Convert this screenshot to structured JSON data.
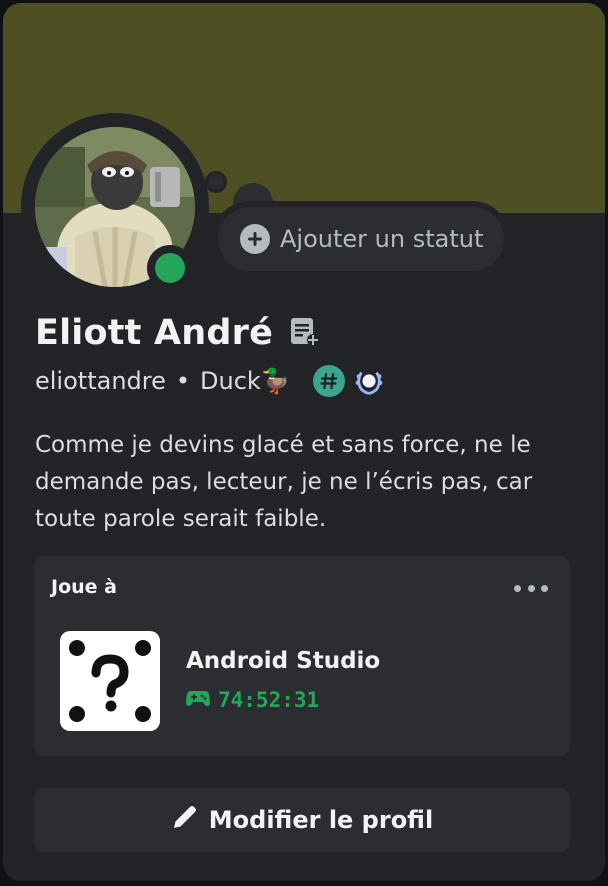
{
  "profile": {
    "display_name": "Eliott André",
    "username": "eliottandre",
    "separator": "•",
    "pronoun_tag": "Duck🦆",
    "bio": "Comme je devins glacé et sans force, ne le demande pas, lecteur, je ne l’écris pas, car toute parole serait faible.",
    "online_status": "online"
  },
  "status": {
    "add_label": "Ajouter un statut"
  },
  "activity": {
    "header": "Joue à",
    "game_name": "Android Studio",
    "elapsed": "74:52:31"
  },
  "actions": {
    "edit_profile_label": "Modifier le profil"
  },
  "colors": {
    "banner": "#4f4f24",
    "card": "#232428",
    "online": "#23a55a",
    "hypesquad_badge": "#3ba58f",
    "quest_badge": "#9bb7ff"
  },
  "icons": {
    "note": "note-add-icon",
    "plus": "plus-circle-icon",
    "hashtag_badge": "hashtag-badge-icon",
    "laurel_badge": "laurel-badge-icon",
    "game": "unknown-game-icon",
    "controller": "gamepad-icon",
    "pencil": "pencil-icon",
    "more": "more-dots-icon"
  }
}
